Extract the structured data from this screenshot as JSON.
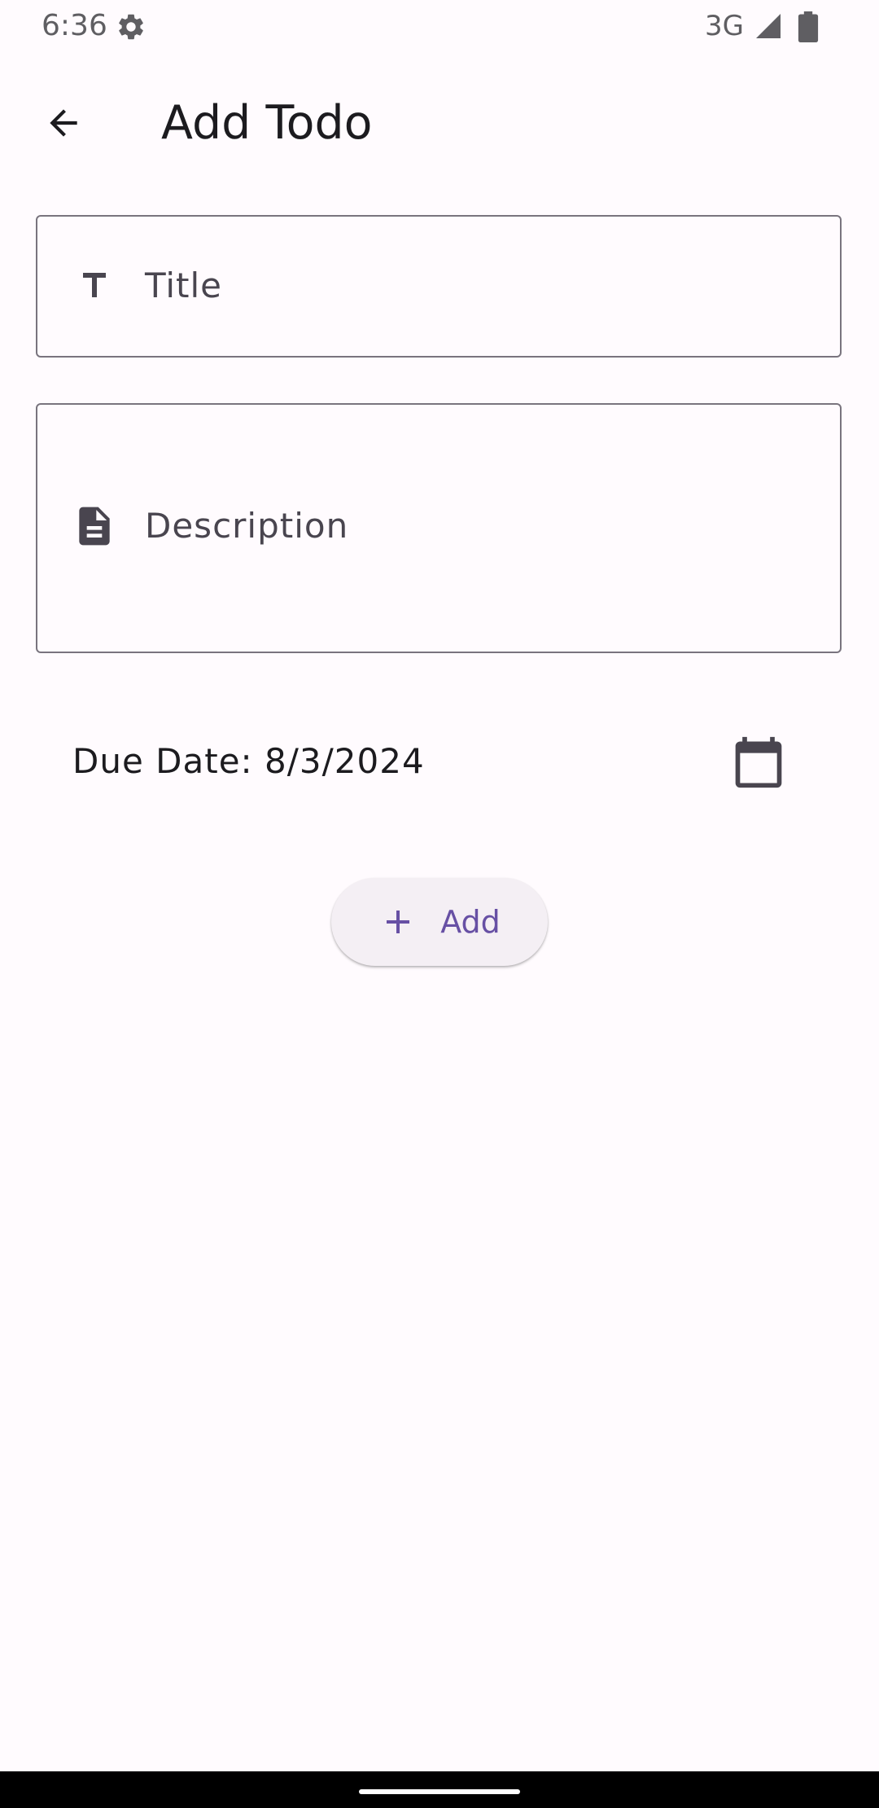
{
  "status_bar": {
    "time": "6:36",
    "network": "3G",
    "icons": [
      "gear-icon",
      "signal-icon",
      "battery-icon"
    ]
  },
  "app_bar": {
    "title": "Add Todo",
    "back_icon": "arrow-back-icon"
  },
  "form": {
    "title_field": {
      "label": "Title",
      "icon": "text-title-icon"
    },
    "description_field": {
      "label": "Description",
      "icon": "document-icon"
    },
    "due_date": {
      "text": "Due Date: 8/3/2024",
      "icon": "calendar-icon"
    },
    "add_button": {
      "label": "Add",
      "icon": "plus-icon"
    }
  },
  "colors": {
    "background": "#fffbfe",
    "primary": "#6750a4",
    "outline": "#79747e",
    "button_surface": "#f4eff4",
    "icon": "#49454f"
  }
}
